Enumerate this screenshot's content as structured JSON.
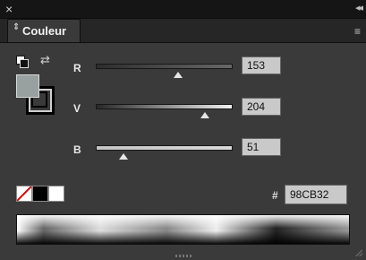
{
  "window": {
    "close_glyph": "×",
    "collapse_glyph": "◂◂"
  },
  "tab": {
    "label": "Couleur",
    "arrows_glyph": "⇕"
  },
  "menu_glyph": "≡",
  "sliders": [
    {
      "label": "R",
      "value": "153",
      "fraction": 0.6
    },
    {
      "label": "V",
      "value": "204",
      "fraction": 0.8
    },
    {
      "label": "B",
      "value": "51",
      "fraction": 0.2
    }
  ],
  "hex": {
    "prefix": "#",
    "value": "98CB32"
  },
  "colors": {
    "fill": "#98a0a0",
    "r_gradient": [
      "#003333",
      "#ff3333"
    ],
    "v_gradient": [
      "#990033",
      "#99ff33"
    ],
    "b_gradient": [
      "#99cc00",
      "#99ccff"
    ]
  },
  "swap_glyph": "⇄"
}
